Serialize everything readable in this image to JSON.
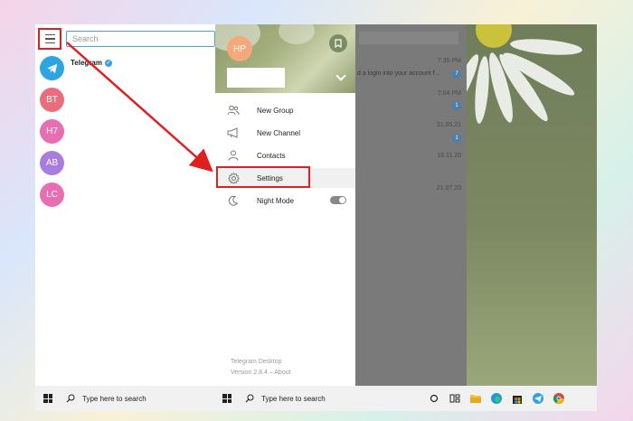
{
  "sidebar": {
    "search_placeholder": "Search",
    "chats": [
      {
        "initials": "",
        "name": "Telegram",
        "color": "#2ca5e0"
      },
      {
        "initials": "BT",
        "color": "#e86e7e"
      },
      {
        "initials": "H7",
        "color": "#e86eb3"
      },
      {
        "initials": "AB",
        "color": "#a97ce0"
      },
      {
        "initials": "LC",
        "color": "#e86eb3"
      }
    ]
  },
  "chat_list": {
    "items": [
      {
        "time": "7:35 PM",
        "preview": "d a login into your account f...",
        "badge": "7"
      },
      {
        "time": "7:04 PM",
        "badge": "1"
      },
      {
        "time": "31.05.21",
        "badge": "1"
      },
      {
        "time": "18.11.20"
      },
      {
        "time": "21.07.20"
      }
    ]
  },
  "menu": {
    "profile_initials": "HP",
    "items": [
      {
        "label": "New Group",
        "icon": "people-icon"
      },
      {
        "label": "New Channel",
        "icon": "megaphone-icon"
      },
      {
        "label": "Contacts",
        "icon": "person-icon"
      },
      {
        "label": "Settings",
        "icon": "gear-icon"
      },
      {
        "label": "Night Mode",
        "icon": "moon-icon"
      }
    ],
    "footer_title": "Telegram Desktop",
    "footer_version": "Version 2.8.4 – About"
  },
  "taskbar": {
    "search_placeholder_1": "Type here to search",
    "search_placeholder_2": "Type here to search"
  },
  "colors": {
    "highlight_red": "#e02020",
    "accent_blue": "#4f9fd9",
    "profile_orange": "#f4a87b"
  }
}
